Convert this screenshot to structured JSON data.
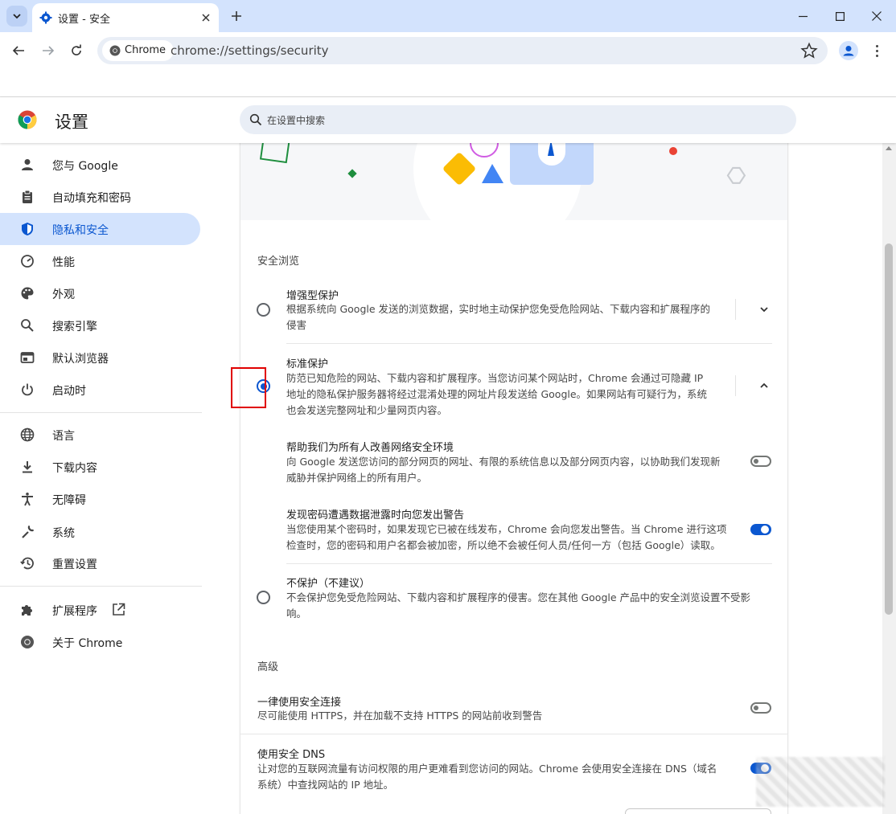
{
  "browser": {
    "tab_title": "设置 - 安全",
    "chip_label": "Chrome",
    "url": "chrome://settings/security"
  },
  "header": {
    "title": "设置",
    "search_placeholder": "在设置中搜索"
  },
  "sidebar": {
    "items": [
      {
        "label": "您与 Google",
        "icon": "person-icon"
      },
      {
        "label": "自动填充和密码",
        "icon": "clipboard-icon"
      },
      {
        "label": "隐私和安全",
        "icon": "shield-icon",
        "active": true
      },
      {
        "label": "性能",
        "icon": "speedometer-icon"
      },
      {
        "label": "外观",
        "icon": "palette-icon"
      },
      {
        "label": "搜索引擎",
        "icon": "search-icon"
      },
      {
        "label": "默认浏览器",
        "icon": "browser-icon"
      },
      {
        "label": "启动时",
        "icon": "power-icon"
      },
      {
        "label": "语言",
        "icon": "globe-icon"
      },
      {
        "label": "下载内容",
        "icon": "download-icon"
      },
      {
        "label": "无障碍",
        "icon": "accessibility-icon"
      },
      {
        "label": "系统",
        "icon": "wrench-icon"
      },
      {
        "label": "重置设置",
        "icon": "history-icon"
      },
      {
        "label": "扩展程序",
        "icon": "puzzle-icon"
      },
      {
        "label": "关于 Chrome",
        "icon": "chrome-icon"
      }
    ]
  },
  "main": {
    "safe_browsing_title": "安全浏览",
    "enhanced": {
      "title": "增强型保护",
      "desc_line1": "根据系统向 Google 发送的浏览数据，实时地主动保护您免受危险网站、下载内容和扩展程序的",
      "desc_line2": "侵害",
      "selected": false
    },
    "standard": {
      "title": "标准保护",
      "desc_line1": "防范已知危险的网站、下载内容和扩展程序。当您访问某个网站时，Chrome 会通过可隐藏 IP",
      "desc_line2": "地址的隐私保护服务器将经过混淆处理的网址片段发送给 Google。如果网站有可疑行为，系统",
      "desc_line3": "也会发送完整网址和少量网页内容。",
      "selected": true
    },
    "help_improve": {
      "title": "帮助我们为所有人改善网络安全环境",
      "desc_line1": "向 Google 发送您访问的部分网页的网址、有限的系统信息以及部分网页内容，以协助我们发现新",
      "desc_line2": "威胁并保护网络上的所有用户。",
      "enabled": false
    },
    "password_warn": {
      "title": "发现密码遭遇数据泄露时向您发出警告",
      "desc_line1": "当您使用某个密码时，如果发现它已被在线发布，Chrome 会向您发出警告。当 Chrome 进行这项",
      "desc_line2": "检查时，您的密码和用户名都会被加密，所以绝不会被任何人员/任何一方（包括 Google）读取。",
      "enabled": true
    },
    "no_protection": {
      "title": "不保护（不建议）",
      "desc_line1": "不会保护您免受危险网站、下载内容和扩展程序的侵害。您在其他 Google 产品中的安全浏览设置不受影",
      "desc_line2": "响。",
      "selected": false
    },
    "advanced_title": "高级",
    "https": {
      "title": "一律使用安全连接",
      "desc": "尽可能使用 HTTPS，并在加载不支持 HTTPS 的网站前收到警告",
      "enabled": false
    },
    "dns": {
      "title": "使用安全 DNS",
      "desc_line1": "让对您的互联网流量有访问权限的用户更难看到您访问的网站。Chrome 会使用安全连接在 DNS（域名",
      "desc_line2": "系统）中查找网站的 IP 地址。",
      "enabled": true
    }
  },
  "colors": {
    "accent": "#0b57d0",
    "active_nav_bg": "#d3e3fd",
    "highlight_box": "#e00000"
  }
}
